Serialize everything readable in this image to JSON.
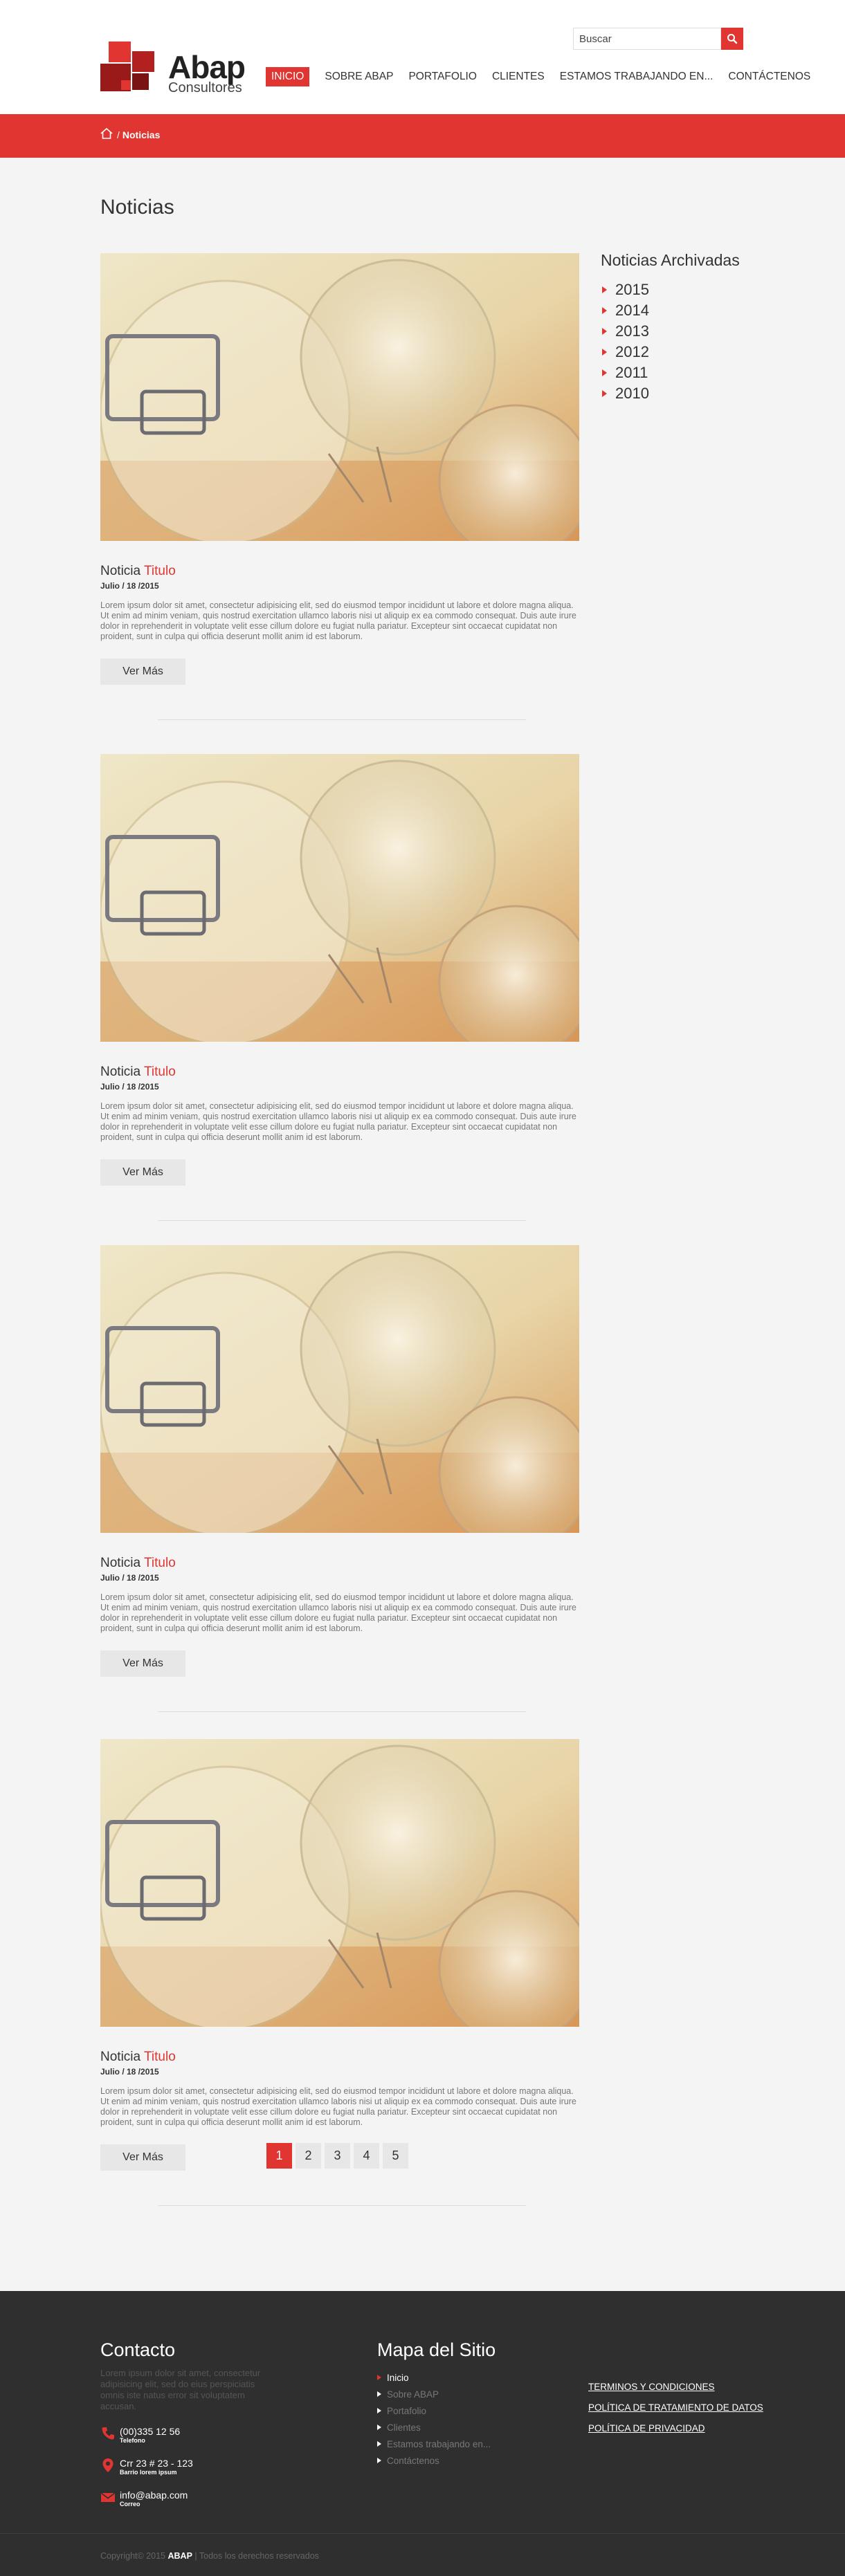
{
  "header": {
    "logo": {
      "brand": "Abap",
      "tagline": "Consultores"
    },
    "search": {
      "placeholder": "Buscar"
    },
    "nav": [
      {
        "label": "INICIO",
        "active": true
      },
      {
        "label": "SOBRE ABAP"
      },
      {
        "label": "PORTAFOLIO"
      },
      {
        "label": "CLIENTES"
      },
      {
        "label": "ESTAMOS TRABAJANDO EN..."
      },
      {
        "label": "CONTÁCTENOS"
      }
    ],
    "accent_color": "#e03530"
  },
  "breadcrumb": {
    "separator": "/",
    "current": "Noticias"
  },
  "page_title": "Noticias",
  "posts": [
    {
      "title_prefix": "Noticia",
      "title_highlight": "Titulo",
      "date": "Julio / 18 /2015",
      "body": "Lorem ipsum dolor sit amet, consectetur adipisicing elit, sed do eiusmod tempor incididunt ut labore et dolore magna aliqua. Ut enim ad minim veniam, quis nostrud exercitation ullamco laboris nisi ut aliquip ex ea commodo consequat. Duis aute irure dolor in reprehenderit in voluptate velit esse cillum dolore eu fugiat nulla pariatur. Excepteur sint occaecat cupidatat non proident, sunt in culpa qui officia deserunt mollit anim id est laborum.",
      "button": "Ver Más"
    },
    {
      "title_prefix": "Noticia",
      "title_highlight": "Titulo",
      "date": "Julio / 18 /2015",
      "body": "Lorem ipsum dolor sit amet, consectetur adipisicing elit, sed do eiusmod tempor incididunt ut labore et dolore magna aliqua. Ut enim ad minim veniam, quis nostrud exercitation ullamco laboris nisi ut aliquip ex ea commodo consequat. Duis aute irure dolor in reprehenderit in voluptate velit esse cillum dolore eu fugiat nulla pariatur. Excepteur sint occaecat cupidatat non proident, sunt in culpa qui officia deserunt mollit anim id est laborum.",
      "button": "Ver Más"
    },
    {
      "title_prefix": "Noticia",
      "title_highlight": "Titulo",
      "date": "Julio / 18 /2015",
      "body": "Lorem ipsum dolor sit amet, consectetur adipisicing elit, sed do eiusmod tempor incididunt ut labore et dolore magna aliqua. Ut enim ad minim veniam, quis nostrud exercitation ullamco laboris nisi ut aliquip ex ea commodo consequat. Duis aute irure dolor in reprehenderit in voluptate velit esse cillum dolore eu fugiat nulla pariatur. Excepteur sint occaecat cupidatat non proident, sunt in culpa qui officia deserunt mollit anim id est laborum.",
      "button": "Ver Más"
    },
    {
      "title_prefix": "Noticia",
      "title_highlight": "Titulo",
      "date": "Julio / 18 /2015",
      "body": "Lorem ipsum dolor sit amet, consectetur adipisicing elit, sed do eiusmod tempor incididunt ut labore et dolore magna aliqua. Ut enim ad minim veniam, quis nostrud exercitation ullamco laboris nisi ut aliquip ex ea commodo consequat. Duis aute irure dolor in reprehenderit in voluptate velit esse cillum dolore eu fugiat nulla pariatur. Excepteur sint occaecat cupidatat non proident, sunt in culpa qui officia deserunt mollit anim id est laborum.",
      "button": "Ver Más"
    }
  ],
  "archive": {
    "title": "Noticias Archivadas",
    "years": [
      "2015",
      "2014",
      "2013",
      "2012",
      "2011",
      "2010"
    ]
  },
  "pagination": {
    "pages": [
      "1",
      "2",
      "3",
      "4",
      "5"
    ],
    "current": "1"
  },
  "footer": {
    "contact": {
      "title": "Contacto",
      "text": "Lorem ipsum dolor sit amet, consectetur adipisicing elit, sed do eius perspiciatis omnis iste natus error sit voluptatem accusan.",
      "phone": {
        "value": "(00)335 12 56",
        "label": "Telefono"
      },
      "address": {
        "value": "Crr 23 # 23 - 123",
        "label": "Barrio lorem ipsum"
      },
      "email": {
        "value": "info@abap.com",
        "label": "Correo"
      }
    },
    "sitemap": {
      "title": "Mapa del Sitio",
      "items": [
        "Inicio",
        "Sobre ABAP",
        "Portafolio",
        "Clientes",
        "Estamos trabajando en...",
        "Contáctenos"
      ]
    },
    "legal": [
      "TERMINOS Y CONDICIONES",
      "POLÍTICA DE TRATAMIENTO DE DATOS",
      "POLÍTICA DE PRIVACIDAD"
    ],
    "copyright": {
      "prefix": "Copyright© 2015",
      "brand": "ABAP",
      "suffix": "| Todos los derechos reservados"
    }
  }
}
